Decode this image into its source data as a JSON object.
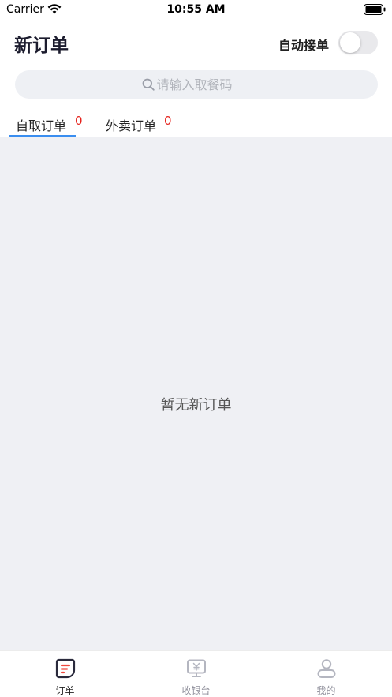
{
  "status_bar": {
    "carrier": "Carrier",
    "time": "10:55 AM"
  },
  "header": {
    "title": "新订单",
    "auto_accept_label": "自动接单",
    "auto_accept_on": false
  },
  "search": {
    "placeholder": "请输入取餐码",
    "value": ""
  },
  "tabs": [
    {
      "label": "自取订单",
      "count": "0",
      "active": true
    },
    {
      "label": "外卖订单",
      "count": "0",
      "active": false
    }
  ],
  "content": {
    "empty_message": "暂无新订单"
  },
  "bottom_nav": [
    {
      "label": "订单",
      "icon": "orders-icon",
      "active": true
    },
    {
      "label": "收银台",
      "icon": "cashier-icon",
      "active": false
    },
    {
      "label": "我的",
      "icon": "profile-icon",
      "active": false
    }
  ],
  "colors": {
    "accent": "#3a8ef0",
    "badge": "#e5201a",
    "background": "#eff0f4",
    "orders_icon_red": "#f0483e"
  }
}
